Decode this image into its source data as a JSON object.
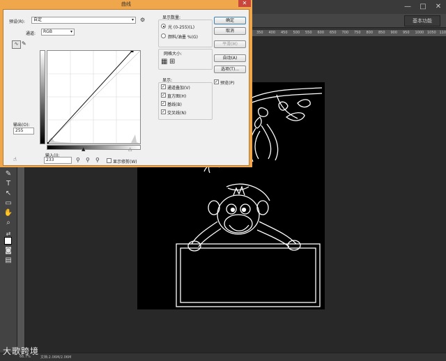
{
  "ps": {
    "window_controls": [
      "—",
      "□",
      "✕"
    ],
    "workspace": "基本功能",
    "ruler_ticks": [
      "350",
      "400",
      "450",
      "500",
      "550",
      "600",
      "650",
      "700",
      "750",
      "800",
      "850",
      "900",
      "950",
      "1000",
      "1050",
      "1100"
    ],
    "status_text": "文档:2.06M/2.06M",
    "zoom_text": "66.7%",
    "watermark": "大歌跨境"
  },
  "curves": {
    "title": "曲线",
    "close": "✕",
    "preset_label": "预设(R):",
    "preset_value": "自定",
    "channel_label": "通道:",
    "channel_value": "RGB",
    "output_label": "输出(O):",
    "output_value": "255",
    "input_label": "输入(I):",
    "input_value": "233",
    "show_clipping": "显示修剪(W)",
    "show_amount_title": "显示数量:",
    "light_option": "光 (0-255)(L)",
    "pigment_option": "颜料/油墨 %(G)",
    "grid_size_title": "网格大小:",
    "display_title": "显示:",
    "display_options": [
      "通道叠加(V)",
      "直方图(H)",
      "基线(B)",
      "交叉线(N)"
    ],
    "buttons": {
      "ok": "确定",
      "cancel": "取消",
      "smooth": "平滑(M)",
      "auto": "自动(A)",
      "options": "选项(T)...",
      "preview": "预览(P)"
    },
    "curve_points": [
      [
        0,
        0
      ],
      [
        233,
        255
      ]
    ]
  }
}
